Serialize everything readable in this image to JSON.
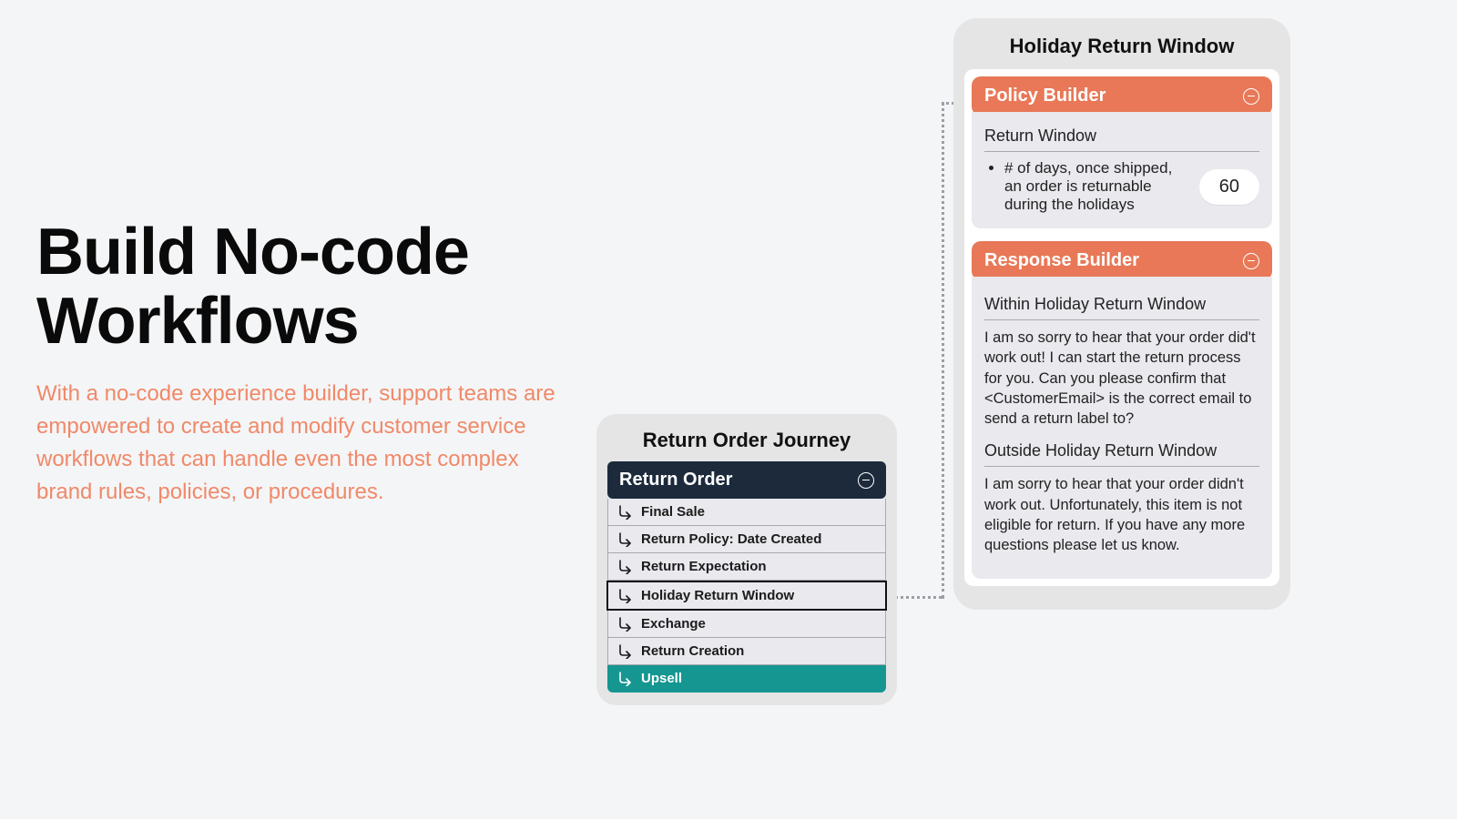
{
  "hero": {
    "title_line1": "Build No-code",
    "title_line2": "Workflows",
    "subtext": "With a no-code experience builder, support teams are empowered to create and modify customer service workflows that can handle even the most complex brand rules, policies, or procedures."
  },
  "journey": {
    "title": "Return Order Journey",
    "header": "Return Order",
    "rows": [
      {
        "label": "Final Sale",
        "highlight": false,
        "teal": false
      },
      {
        "label": "Return Policy: Date Created",
        "highlight": false,
        "teal": false
      },
      {
        "label": "Return Expectation",
        "highlight": false,
        "teal": false
      },
      {
        "label": "Holiday Return Window",
        "highlight": true,
        "teal": false
      },
      {
        "label": "Exchange",
        "highlight": false,
        "teal": false
      },
      {
        "label": "Return Creation",
        "highlight": false,
        "teal": false
      },
      {
        "label": "Upsell",
        "highlight": false,
        "teal": true
      }
    ]
  },
  "detail": {
    "title": "Holiday Return Window",
    "policy": {
      "header": "Policy Builder",
      "section": "Return Window",
      "bullet": "# of days, once shipped, an order is returnable during the holidays",
      "value": "60"
    },
    "response": {
      "header": "Response Builder",
      "section1": "Within Holiday Return Window",
      "body1": "I am so sorry to hear that your order did't work out! I can start the return process for you. Can you please confirm that <CustomerEmail> is the correct email to send a return label to?",
      "section2": "Outside Holiday Return Window",
      "body2": "I am sorry to hear that your order didn't work out.  Unfortunately, this item is not eligible for return. If you have any more questions please let us know."
    }
  }
}
